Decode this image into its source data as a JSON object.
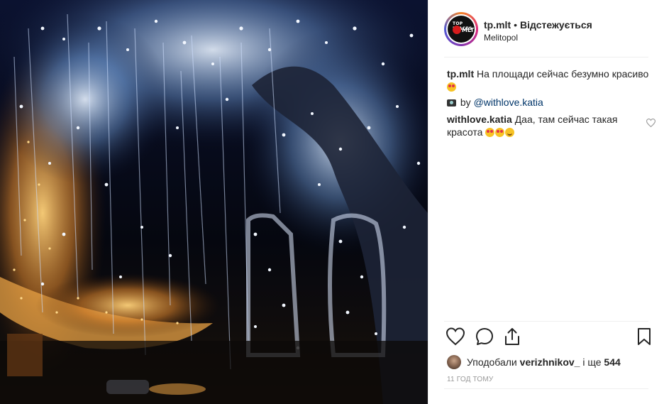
{
  "post": {
    "image_alt": "",
    "header": {
      "username": "tp.mlt",
      "separator": "•",
      "follow_label": "Відстежується",
      "location": "Melitopol",
      "avatar_text_top": "TOP PLACES",
      "avatar_text_mlt": "MLT"
    },
    "caption": {
      "username": "tp.mlt",
      "text": "На площади сейчас безумно красиво",
      "emoji": "heart-eyes-emoji",
      "credit_prefix": "by",
      "credit_handle": "@withlove.katia",
      "camera_icon": "camera-icon"
    },
    "comment": {
      "username": "withlove.katia",
      "text": "Даа, там сейчас такая красота",
      "emoji": [
        "heart-eyes-emoji",
        "heart-eyes-emoji",
        "smiling-emoji"
      ]
    },
    "actions": {
      "like_icon": "heart-icon",
      "comment_icon": "comment-icon",
      "share_icon": "share-icon",
      "save_icon": "bookmark-icon"
    },
    "likes": {
      "prefix": "Уподобали",
      "user": "verizhnikov_",
      "middle": "і ще",
      "count": "544"
    },
    "timestamp": "11 год тому",
    "colors": {
      "text": "#262626",
      "link": "#003569",
      "muted": "#999999",
      "divider": "#efefef"
    }
  }
}
